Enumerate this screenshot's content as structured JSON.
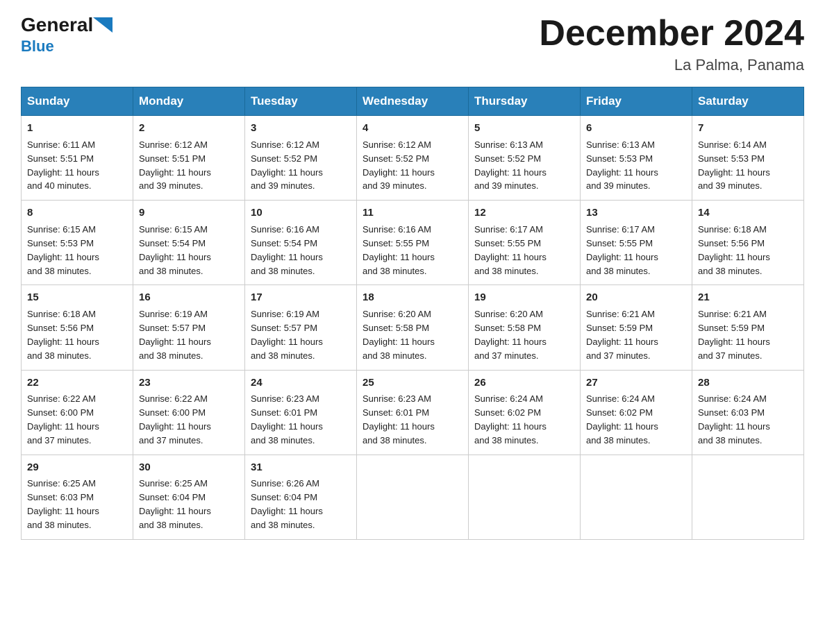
{
  "header": {
    "logo_general": "General",
    "logo_blue": "Blue",
    "title": "December 2024",
    "location": "La Palma, Panama"
  },
  "calendar": {
    "days_of_week": [
      "Sunday",
      "Monday",
      "Tuesday",
      "Wednesday",
      "Thursday",
      "Friday",
      "Saturday"
    ],
    "weeks": [
      [
        {
          "day": "1",
          "sunrise": "6:11 AM",
          "sunset": "5:51 PM",
          "daylight": "11 hours and 40 minutes."
        },
        {
          "day": "2",
          "sunrise": "6:12 AM",
          "sunset": "5:51 PM",
          "daylight": "11 hours and 39 minutes."
        },
        {
          "day": "3",
          "sunrise": "6:12 AM",
          "sunset": "5:52 PM",
          "daylight": "11 hours and 39 minutes."
        },
        {
          "day": "4",
          "sunrise": "6:12 AM",
          "sunset": "5:52 PM",
          "daylight": "11 hours and 39 minutes."
        },
        {
          "day": "5",
          "sunrise": "6:13 AM",
          "sunset": "5:52 PM",
          "daylight": "11 hours and 39 minutes."
        },
        {
          "day": "6",
          "sunrise": "6:13 AM",
          "sunset": "5:53 PM",
          "daylight": "11 hours and 39 minutes."
        },
        {
          "day": "7",
          "sunrise": "6:14 AM",
          "sunset": "5:53 PM",
          "daylight": "11 hours and 39 minutes."
        }
      ],
      [
        {
          "day": "8",
          "sunrise": "6:15 AM",
          "sunset": "5:53 PM",
          "daylight": "11 hours and 38 minutes."
        },
        {
          "day": "9",
          "sunrise": "6:15 AM",
          "sunset": "5:54 PM",
          "daylight": "11 hours and 38 minutes."
        },
        {
          "day": "10",
          "sunrise": "6:16 AM",
          "sunset": "5:54 PM",
          "daylight": "11 hours and 38 minutes."
        },
        {
          "day": "11",
          "sunrise": "6:16 AM",
          "sunset": "5:55 PM",
          "daylight": "11 hours and 38 minutes."
        },
        {
          "day": "12",
          "sunrise": "6:17 AM",
          "sunset": "5:55 PM",
          "daylight": "11 hours and 38 minutes."
        },
        {
          "day": "13",
          "sunrise": "6:17 AM",
          "sunset": "5:55 PM",
          "daylight": "11 hours and 38 minutes."
        },
        {
          "day": "14",
          "sunrise": "6:18 AM",
          "sunset": "5:56 PM",
          "daylight": "11 hours and 38 minutes."
        }
      ],
      [
        {
          "day": "15",
          "sunrise": "6:18 AM",
          "sunset": "5:56 PM",
          "daylight": "11 hours and 38 minutes."
        },
        {
          "day": "16",
          "sunrise": "6:19 AM",
          "sunset": "5:57 PM",
          "daylight": "11 hours and 38 minutes."
        },
        {
          "day": "17",
          "sunrise": "6:19 AM",
          "sunset": "5:57 PM",
          "daylight": "11 hours and 38 minutes."
        },
        {
          "day": "18",
          "sunrise": "6:20 AM",
          "sunset": "5:58 PM",
          "daylight": "11 hours and 38 minutes."
        },
        {
          "day": "19",
          "sunrise": "6:20 AM",
          "sunset": "5:58 PM",
          "daylight": "11 hours and 37 minutes."
        },
        {
          "day": "20",
          "sunrise": "6:21 AM",
          "sunset": "5:59 PM",
          "daylight": "11 hours and 37 minutes."
        },
        {
          "day": "21",
          "sunrise": "6:21 AM",
          "sunset": "5:59 PM",
          "daylight": "11 hours and 37 minutes."
        }
      ],
      [
        {
          "day": "22",
          "sunrise": "6:22 AM",
          "sunset": "6:00 PM",
          "daylight": "11 hours and 37 minutes."
        },
        {
          "day": "23",
          "sunrise": "6:22 AM",
          "sunset": "6:00 PM",
          "daylight": "11 hours and 37 minutes."
        },
        {
          "day": "24",
          "sunrise": "6:23 AM",
          "sunset": "6:01 PM",
          "daylight": "11 hours and 38 minutes."
        },
        {
          "day": "25",
          "sunrise": "6:23 AM",
          "sunset": "6:01 PM",
          "daylight": "11 hours and 38 minutes."
        },
        {
          "day": "26",
          "sunrise": "6:24 AM",
          "sunset": "6:02 PM",
          "daylight": "11 hours and 38 minutes."
        },
        {
          "day": "27",
          "sunrise": "6:24 AM",
          "sunset": "6:02 PM",
          "daylight": "11 hours and 38 minutes."
        },
        {
          "day": "28",
          "sunrise": "6:24 AM",
          "sunset": "6:03 PM",
          "daylight": "11 hours and 38 minutes."
        }
      ],
      [
        {
          "day": "29",
          "sunrise": "6:25 AM",
          "sunset": "6:03 PM",
          "daylight": "11 hours and 38 minutes."
        },
        {
          "day": "30",
          "sunrise": "6:25 AM",
          "sunset": "6:04 PM",
          "daylight": "11 hours and 38 minutes."
        },
        {
          "day": "31",
          "sunrise": "6:26 AM",
          "sunset": "6:04 PM",
          "daylight": "11 hours and 38 minutes."
        },
        null,
        null,
        null,
        null
      ]
    ],
    "labels": {
      "sunrise": "Sunrise:",
      "sunset": "Sunset:",
      "daylight": "Daylight:"
    }
  }
}
